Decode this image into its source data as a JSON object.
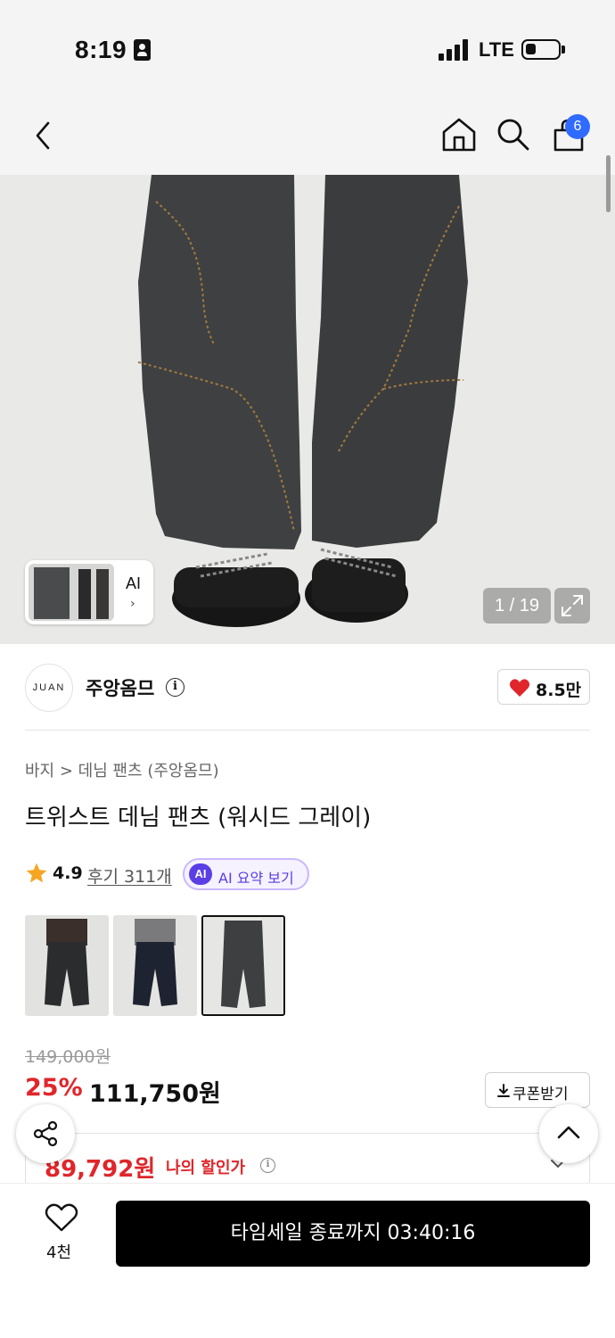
{
  "status_bar": {
    "time": "8:19",
    "network": "LTE",
    "icons": [
      "id-card-icon",
      "signal-icon",
      "battery-icon"
    ]
  },
  "nav": {
    "icons": [
      "back-icon",
      "home-icon",
      "search-icon",
      "cart-icon"
    ],
    "cart_count": "6"
  },
  "gallery": {
    "thumb_label": "AI",
    "counter": "1 / 19"
  },
  "brand": {
    "logo_text": "JUAN",
    "name": "주앙옴므",
    "likes": "8.5만"
  },
  "product": {
    "breadcrumb": "바지 > 데님 팬츠 (주앙옴므)",
    "title": "트위스트 데님 팬츠 (워시드 그레이)",
    "rating": "4.9",
    "reviews": "후기 311개",
    "ai_badge": "AI",
    "ai_summary": "AI 요약 보기"
  },
  "price": {
    "original": "149,000원",
    "discount": "25%",
    "sale": "111,750원",
    "coupon": "쿠폰받기",
    "my_price": "89,792원",
    "my_price_label": "나의 할인가"
  },
  "bottom": {
    "wish_count": "4천",
    "cta": "타임세일 종료까지 03:40:16"
  },
  "colors": {
    "accent_red": "#e0262b",
    "cart_badge": "#2f6bff",
    "ai_purple": "#5a3ee6",
    "cta_bg": "#000000"
  }
}
